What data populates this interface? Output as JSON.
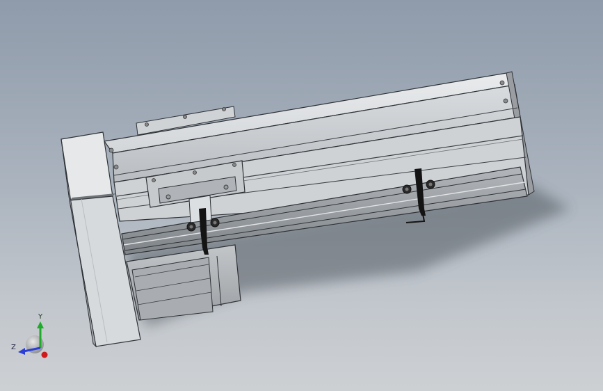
{
  "viewport": {
    "background_top": "#8f9bab",
    "background_bottom": "#cdd0d3"
  },
  "model": {
    "body_color": "#d6d9dc",
    "face_light": "#e4e6e8",
    "face_mid": "#c7cacd",
    "face_dark": "#8c9094",
    "edge_color": "#2e3236",
    "shadow_color": "#3f464d",
    "sensor_color": "#111111"
  },
  "triad": {
    "axis_y_label": "Y",
    "axis_z_label": "Z",
    "axis_y_color": "#1faa2a",
    "axis_z_color": "#2b3fd6",
    "axis_x_color": "#d01a1a"
  }
}
